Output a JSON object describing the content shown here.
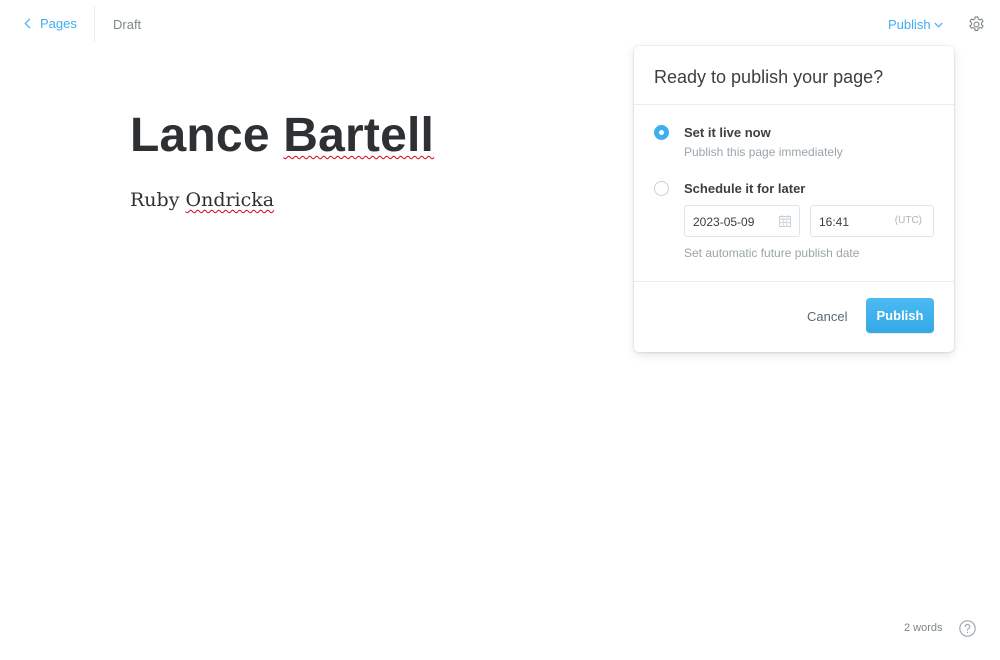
{
  "header": {
    "back_label": "Pages",
    "status": "Draft",
    "publish_menu_label": "Publish"
  },
  "icons": {
    "back": "chevron-left-icon",
    "dropdown": "chevron-down-icon",
    "settings": "gear-icon",
    "calendar": "calendar-icon",
    "help": "question-circle-icon"
  },
  "colors": {
    "accent": "#3eb0ef",
    "title_text": "#2d3133",
    "muted_text": "#9aa5ab",
    "spellcheck": "#d0021b"
  },
  "editor": {
    "title_parts": [
      "Lance",
      "Bartell"
    ],
    "body_parts": [
      "Ruby",
      "Ondricka"
    ]
  },
  "publish_popover": {
    "title": "Ready to publish your page?",
    "options": [
      {
        "label": "Set it live now",
        "description": "Publish this page immediately",
        "selected": true
      },
      {
        "label": "Schedule it for later",
        "description": "",
        "selected": false
      }
    ],
    "schedule": {
      "date_value": "2023-05-09",
      "time_value": "16:41",
      "timezone": "(UTC)",
      "help": "Set automatic future publish date"
    },
    "cancel_label": "Cancel",
    "publish_label": "Publish"
  },
  "footer": {
    "word_count": "2 words"
  }
}
